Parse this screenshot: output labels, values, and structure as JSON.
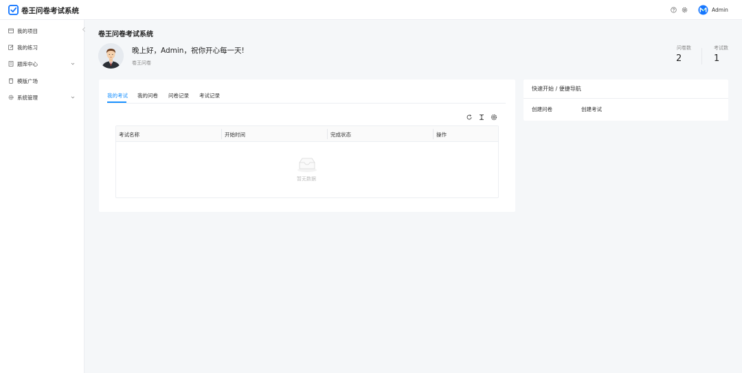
{
  "header": {
    "app_title": "卷王问卷考试系统",
    "user_name": "Admin",
    "icons": [
      "logo-icon",
      "help-icon",
      "gear-icon",
      "avatar-icon"
    ],
    "accent_color": "#1890ff"
  },
  "sidebar": {
    "items": [
      {
        "label": "我的项目",
        "icon": "project-icon",
        "has_children": false
      },
      {
        "label": "我的练习",
        "icon": "edit-icon",
        "has_children": false
      },
      {
        "label": "题库中心",
        "icon": "book-icon",
        "has_children": true
      },
      {
        "label": "模版广场",
        "icon": "template-icon",
        "has_children": false
      },
      {
        "label": "系统管理",
        "icon": "gear-icon",
        "has_children": true
      }
    ]
  },
  "main": {
    "title": "卷王问卷考试系统",
    "greeting": "晚上好，Admin，祝你开心每一天!",
    "greeting_sub": "卷王问卷",
    "stats": [
      {
        "label": "问卷数",
        "value": "2"
      },
      {
        "label": "考试数",
        "value": "1"
      }
    ],
    "tabs": [
      {
        "label": "我的考试",
        "active": true
      },
      {
        "label": "我的问卷",
        "active": false
      },
      {
        "label": "问卷记录",
        "active": false
      },
      {
        "label": "考试记录",
        "active": false
      }
    ],
    "table": {
      "columns": [
        "考试名称",
        "开始时间",
        "完成状态",
        "操作"
      ],
      "empty_text": "暂无数据"
    }
  },
  "quick_start": {
    "title": "快速开始 / 便捷导航",
    "links": [
      "创建问卷",
      "创建考试"
    ]
  }
}
